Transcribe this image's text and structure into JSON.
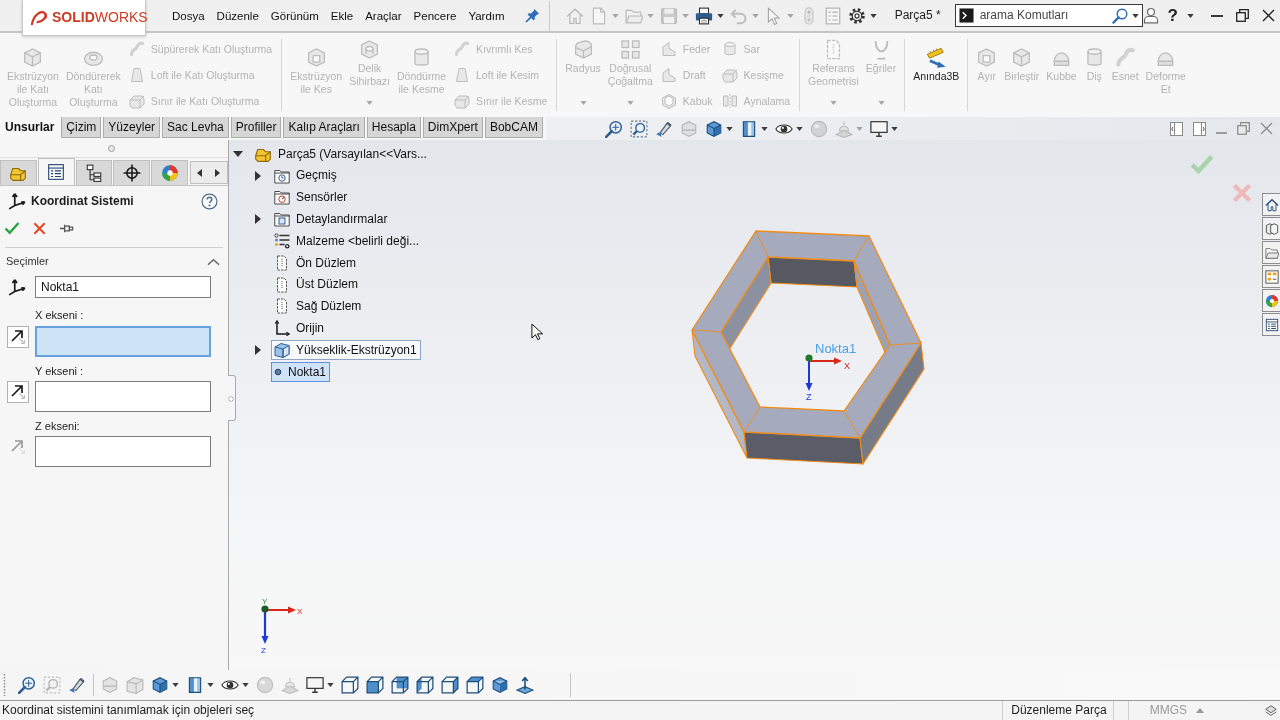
{
  "top_bar": {
    "logo": "**SOLID**WORKS",
    "menu": [
      "Dosya",
      "Düzenle",
      "Görünüm",
      "Ekle",
      "Araçlar",
      "Pencere",
      "Yardım"
    ],
    "quick_tools": [
      {
        "disabled": true,
        "dropdown": false
      },
      {
        "disabled": true,
        "dropdown": true
      },
      {
        "disabled": true,
        "dropdown": true
      },
      {
        "disabled": true,
        "dropdown": true
      },
      {
        "disabled": false,
        "dropdown": true
      },
      {
        "disabled": true,
        "dropdown": true
      },
      {
        "disabled": true,
        "dropdown": true
      },
      {
        "disabled": true,
        "dropdown": false
      },
      {
        "disabled": true,
        "dropdown": false
      },
      {
        "disabled": false,
        "dropdown": true
      }
    ],
    "document_title": "Parça5 *",
    "search": {
      "placeholder": "arama Komutları"
    },
    "help": "?"
  },
  "ribbon": {
    "groups": [
      [
        {
          "kind": "large",
          "label": "Ekstrüzyon\nile Katı\nOluşturma",
          "disabled": true,
          "dropdown": false
        },
        {
          "kind": "large",
          "label": "Döndürerek\nKatı\nOluşturma",
          "disabled": true,
          "dropdown": false
        },
        {
          "kind": "stack",
          "items": [
            {
              "label": "Süpürerek Katı Oluşturma",
              "disabled": true
            },
            {
              "label": "Loft ile Katı Oluşturma",
              "disabled": true
            },
            {
              "label": "Sınır ile Katı Oluşturma",
              "disabled": true
            }
          ]
        }
      ],
      [
        {
          "kind": "large",
          "label": "Ekstrüzyon\nile Kes",
          "disabled": true,
          "dropdown": false
        },
        {
          "kind": "large",
          "label": "Delik\nSihirbazı",
          "disabled": true,
          "dropdown": true
        },
        {
          "kind": "large",
          "label": "Döndürme\nile Kesme",
          "disabled": true,
          "dropdown": false
        },
        {
          "kind": "stack",
          "items": [
            {
              "label": "Kıvrımlı Kes",
              "disabled": true
            },
            {
              "label": "Loft ile Kesim",
              "disabled": true
            },
            {
              "label": "Sınır ile Kesme",
              "disabled": true
            }
          ]
        }
      ],
      [
        {
          "kind": "large",
          "label": "Radyus",
          "disabled": true,
          "dropdown": true
        },
        {
          "kind": "large",
          "label": "Doğrusal\nÇoğaltma",
          "disabled": true,
          "dropdown": true
        },
        {
          "kind": "stack",
          "items": [
            {
              "label": "Feder",
              "disabled": true
            },
            {
              "label": "Draft",
              "disabled": true
            },
            {
              "label": "Kabuk",
              "disabled": true
            }
          ]
        },
        {
          "kind": "stack",
          "items": [
            {
              "label": "Sar",
              "disabled": true
            },
            {
              "label": "Kesişme",
              "disabled": true
            },
            {
              "label": "Aynalama",
              "disabled": true
            }
          ]
        }
      ],
      [
        {
          "kind": "large",
          "label": "Referans\nGeometrisi",
          "disabled": true,
          "dropdown": true
        },
        {
          "kind": "large",
          "label": "Eğriler",
          "disabled": true,
          "dropdown": true
        }
      ],
      [
        {
          "kind": "large",
          "label": "Anında3B",
          "disabled": false,
          "dropdown": false
        }
      ],
      [
        {
          "kind": "large",
          "label": "Ayır",
          "disabled": true,
          "dropdown": false
        },
        {
          "kind": "large",
          "label": "Birleştir",
          "disabled": true,
          "dropdown": false
        },
        {
          "kind": "large",
          "label": "Kubbe",
          "disabled": true,
          "dropdown": false
        },
        {
          "kind": "large",
          "label": "Diş",
          "disabled": true,
          "dropdown": false
        },
        {
          "kind": "large",
          "label": "Esnet",
          "disabled": true,
          "dropdown": false
        },
        {
          "kind": "large",
          "label": "Deforme\nEt",
          "disabled": true,
          "dropdown": false
        }
      ]
    ]
  },
  "command_tabs": [
    {
      "label": "Unsurlar",
      "selected": true
    },
    {
      "label": "Çizim",
      "selected": false
    },
    {
      "label": "Yüzeyler",
      "selected": false
    },
    {
      "label": "Sac Levha",
      "selected": false
    },
    {
      "label": "Profiller",
      "selected": false
    },
    {
      "label": "Kalıp Araçları",
      "selected": false
    },
    {
      "label": "Hesapla",
      "selected": false
    },
    {
      "label": "DimXpert",
      "selected": false
    },
    {
      "label": "BobCAM",
      "selected": false
    }
  ],
  "heads_up_tools": [
    {
      "disabled": false,
      "dropdown": false
    },
    {
      "disabled": false,
      "dropdown": false
    },
    {
      "disabled": false,
      "dropdown": false
    },
    {
      "disabled": true,
      "dropdown": false
    },
    {
      "disabled": false,
      "dropdown": true
    },
    {
      "disabled": false,
      "dropdown": true
    },
    {
      "disabled": false,
      "dropdown": true
    },
    {
      "disabled": true,
      "dropdown": false
    },
    {
      "disabled": true,
      "dropdown": true
    },
    {
      "disabled": false,
      "dropdown": true
    }
  ],
  "property_manager": {
    "tabs": [
      {
        "selected": false
      },
      {
        "selected": true
      },
      {
        "selected": false
      },
      {
        "selected": false
      },
      {
        "selected": false
      }
    ],
    "title": "Koordinat Sistemi",
    "section": {
      "title": "Seçimler",
      "expanded": true
    },
    "origin_field": {
      "value": "Nokta1"
    },
    "axes": [
      {
        "label": "X ekseni :",
        "focused": true,
        "direction_disabled": false
      },
      {
        "label": "Y ekseni :",
        "focused": false,
        "direction_disabled": false
      },
      {
        "label": "Z ekseni:",
        "focused": false,
        "direction_disabled": true
      }
    ]
  },
  "feature_tree": {
    "label": "Parça5 (Varsayılan<<Vars...",
    "expanded": true,
    "selected": false,
    "highlighted": false,
    "children": [
      {
        "label": "Geçmiş",
        "expanded": false,
        "selected": false,
        "highlighted": false
      },
      {
        "label": "Sensörler",
        "selected": false,
        "highlighted": false
      },
      {
        "label": "Detaylandırmalar",
        "expanded": false,
        "selected": false,
        "highlighted": false
      },
      {
        "label": "Malzeme <belirli deği...",
        "selected": false,
        "highlighted": false
      },
      {
        "label": "Ön Düzlem",
        "selected": false,
        "highlighted": false
      },
      {
        "label": "Üst Düzlem",
        "selected": false,
        "highlighted": false
      },
      {
        "label": "Sağ Düzlem",
        "selected": false,
        "highlighted": false
      },
      {
        "label": "Orijin",
        "selected": false,
        "highlighted": false
      },
      {
        "label": "Yükseklik-Ekstrüzyon1",
        "expanded": false,
        "selected": false,
        "highlighted": true
      },
      {
        "label": "Nokta1",
        "selected": true,
        "highlighted": false
      }
    ]
  },
  "viewport": {
    "point_label": "Nokta1",
    "origin_axes": [
      "X",
      "Z"
    ],
    "view_triad_axes": [
      "Y",
      "X",
      "Z"
    ]
  },
  "view_toolbar": [
    {
      "disabled": false,
      "dropdown": false
    },
    {
      "disabled": true,
      "dropdown": false
    },
    {
      "disabled": false,
      "dropdown": false
    },
    {
      "disabled": true,
      "dropdown": false
    },
    {
      "disabled": true,
      "dropdown": false
    },
    {
      "disabled": false,
      "dropdown": true
    },
    {
      "disabled": false,
      "dropdown": true
    },
    {
      "disabled": false,
      "dropdown": true
    },
    {
      "disabled": true,
      "dropdown": false
    },
    {
      "disabled": true,
      "dropdown": false
    },
    {
      "disabled": false,
      "dropdown": true
    },
    {
      "disabled": false,
      "dropdown": false
    },
    {
      "disabled": false,
      "dropdown": false
    },
    {
      "disabled": false,
      "dropdown": false
    },
    {
      "disabled": false,
      "dropdown": false
    },
    {
      "disabled": false,
      "dropdown": false
    },
    {
      "disabled": false,
      "dropdown": false
    },
    {
      "disabled": false,
      "dropdown": false
    },
    {
      "disabled": false,
      "dropdown": false
    }
  ],
  "status_bar": {
    "message": "Koordinat sistemini tanımlamak için objeleri seç",
    "mode": "Düzenleme Parça",
    "units": "MMGS"
  }
}
